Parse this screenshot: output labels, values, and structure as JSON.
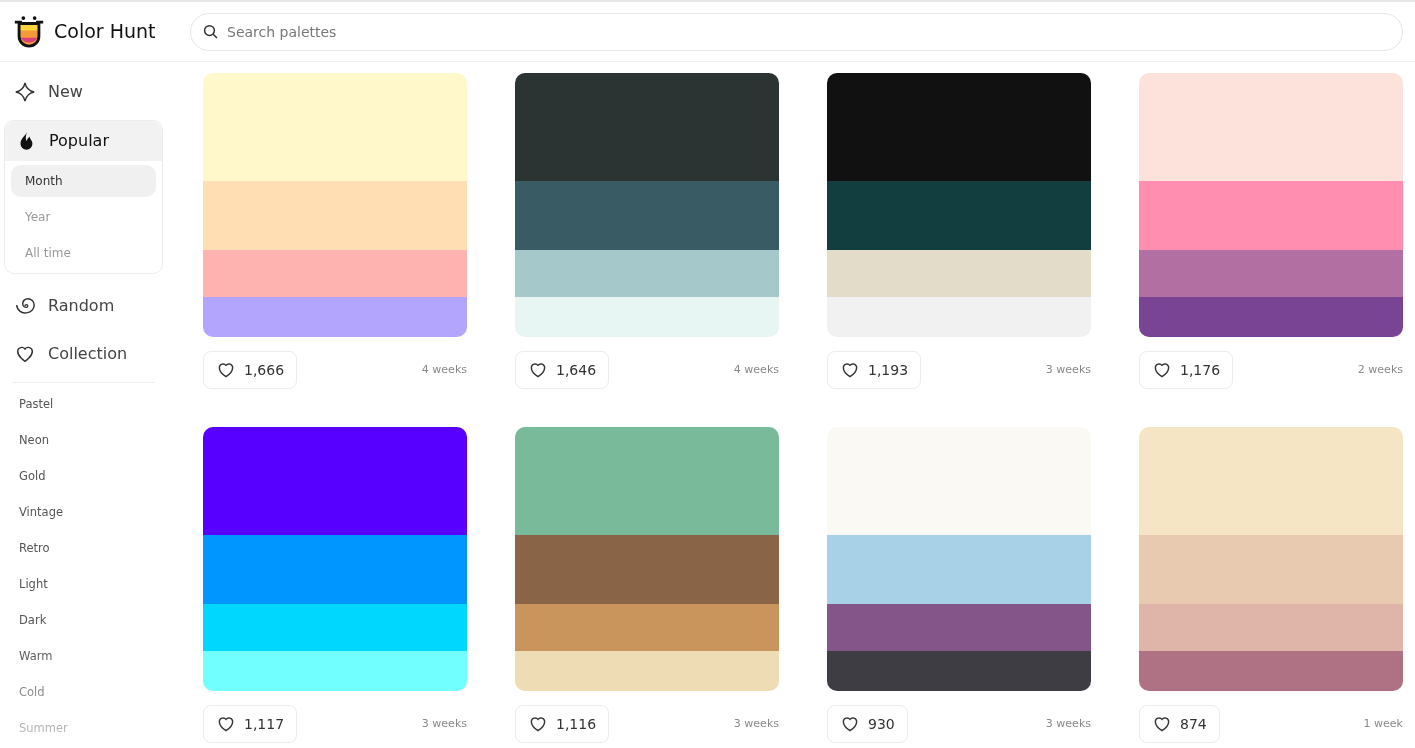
{
  "brand": {
    "name": "Color Hunt"
  },
  "search": {
    "placeholder": "Search palettes"
  },
  "nav": [
    {
      "kind": "new",
      "label": "New",
      "selected": false
    },
    {
      "kind": "popular",
      "label": "Popular",
      "selected": true,
      "children": [
        {
          "label": "Month",
          "selected": true
        },
        {
          "label": "Year",
          "selected": false
        },
        {
          "label": "All time",
          "selected": false
        }
      ]
    },
    {
      "kind": "random",
      "label": "Random",
      "selected": false
    },
    {
      "kind": "collection",
      "label": "Collection",
      "selected": false
    }
  ],
  "tags": [
    "Pastel",
    "Neon",
    "Gold",
    "Vintage",
    "Retro",
    "Light",
    "Dark",
    "Warm",
    "Cold",
    "Summer"
  ],
  "palettes": [
    {
      "swatches": [
        {
          "color": "#fff8ca"
        },
        {
          "color": "#fedeb2"
        },
        {
          "color": "#feb3b0"
        },
        {
          "color": "#b3a5fd"
        }
      ],
      "likes": "1,666",
      "age": "4 weeks"
    },
    {
      "swatches": [
        {
          "color": "#2c3333"
        },
        {
          "color": "#395b64"
        },
        {
          "color": "#a5c9ca"
        },
        {
          "color": "#e7f6f2"
        }
      ],
      "likes": "1,646",
      "age": "4 weeks"
    },
    {
      "swatches": [
        {
          "color": "#111111"
        },
        {
          "color": "#123e3f"
        },
        {
          "color": "#e3dcc9"
        },
        {
          "color": "#f1f1f1"
        }
      ],
      "likes": "1,193",
      "age": "3 weeks"
    },
    {
      "swatches": [
        {
          "color": "#fde2db"
        },
        {
          "color": "#ff8eb0"
        },
        {
          "color": "#b26fa1"
        },
        {
          "color": "#7a4495"
        }
      ],
      "likes": "1,176",
      "age": "2 weeks"
    },
    {
      "swatches": [
        {
          "color": "#5800ff"
        },
        {
          "color": "#0096ff"
        },
        {
          "color": "#00d7ff"
        },
        {
          "color": "#72ffff"
        }
      ],
      "likes": "1,117",
      "age": "3 weeks"
    },
    {
      "swatches": [
        {
          "color": "#78ba99"
        },
        {
          "color": "#896446"
        },
        {
          "color": "#ca955c"
        },
        {
          "color": "#eddcb4"
        }
      ],
      "likes": "1,116",
      "age": "3 weeks"
    },
    {
      "swatches": [
        {
          "color": "#fbf9f4"
        },
        {
          "color": "#a8d1e7"
        },
        {
          "color": "#835588"
        },
        {
          "color": "#3e3d44"
        }
      ],
      "likes": "930",
      "age": "3 weeks"
    },
    {
      "swatches": [
        {
          "color": "#f5e5c5"
        },
        {
          "color": "#e8cab1"
        },
        {
          "color": "#dfb4a9"
        },
        {
          "color": "#af7285"
        }
      ],
      "likes": "874",
      "age": "1 week"
    }
  ]
}
